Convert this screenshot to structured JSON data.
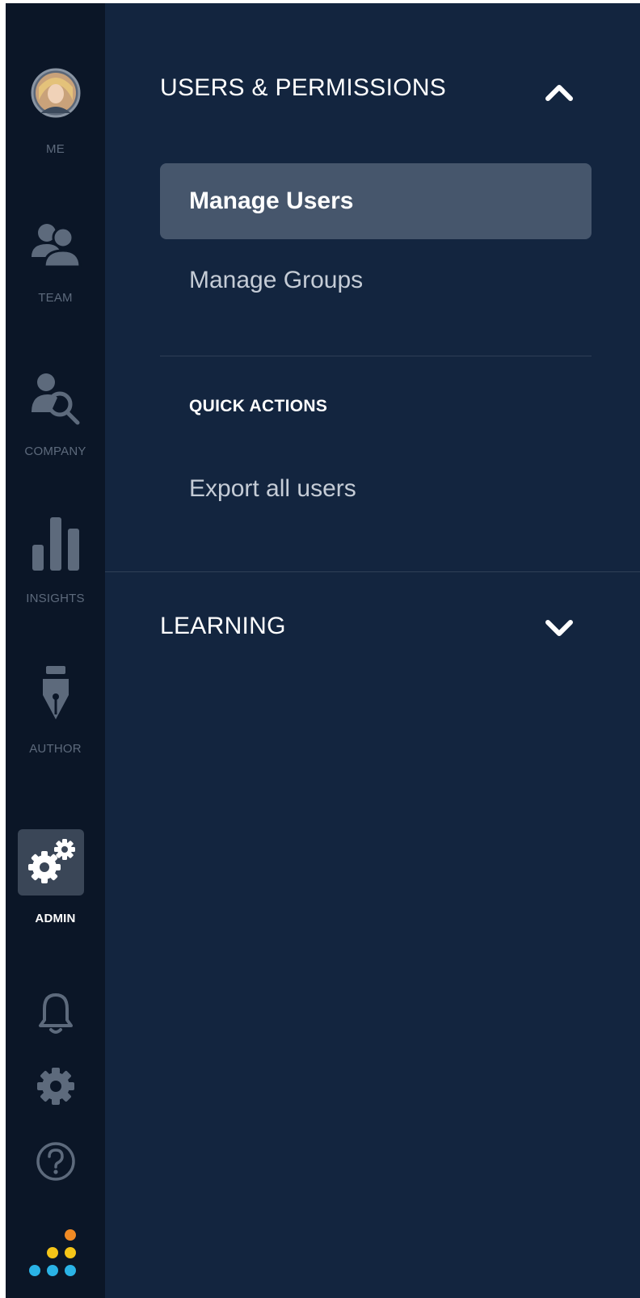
{
  "rail": {
    "items": [
      {
        "label": "ME",
        "icon": "avatar"
      },
      {
        "label": "TEAM",
        "icon": "team-icon"
      },
      {
        "label": "COMPANY",
        "icon": "company-search-icon"
      },
      {
        "label": "INSIGHTS",
        "icon": "bar-chart-icon"
      },
      {
        "label": "AUTHOR",
        "icon": "pen-nib-icon"
      },
      {
        "label": "ADMIN",
        "icon": "gears-icon",
        "active": true
      }
    ],
    "bottom_icons": [
      "bell-icon",
      "gear-icon",
      "help-icon",
      "logo-dots-icon"
    ]
  },
  "panel": {
    "users_permissions": {
      "title": "USERS & PERMISSIONS",
      "expanded": true,
      "items": [
        {
          "label": "Manage Users",
          "selected": true
        },
        {
          "label": "Manage Groups",
          "selected": false
        }
      ],
      "quick_actions": {
        "heading": "QUICK ACTIONS",
        "items": [
          {
            "label": "Export all users"
          }
        ]
      }
    },
    "learning": {
      "title": "LEARNING",
      "expanded": false
    }
  },
  "colors": {
    "rail_bg": "#0b1627",
    "panel_bg": "#13253f",
    "selected_bg": "#46566c",
    "inactive_icon": "#5d6a7c",
    "logo_orange": "#f08a24",
    "logo_yellow": "#f5c518",
    "logo_blue": "#2ab3e6"
  }
}
